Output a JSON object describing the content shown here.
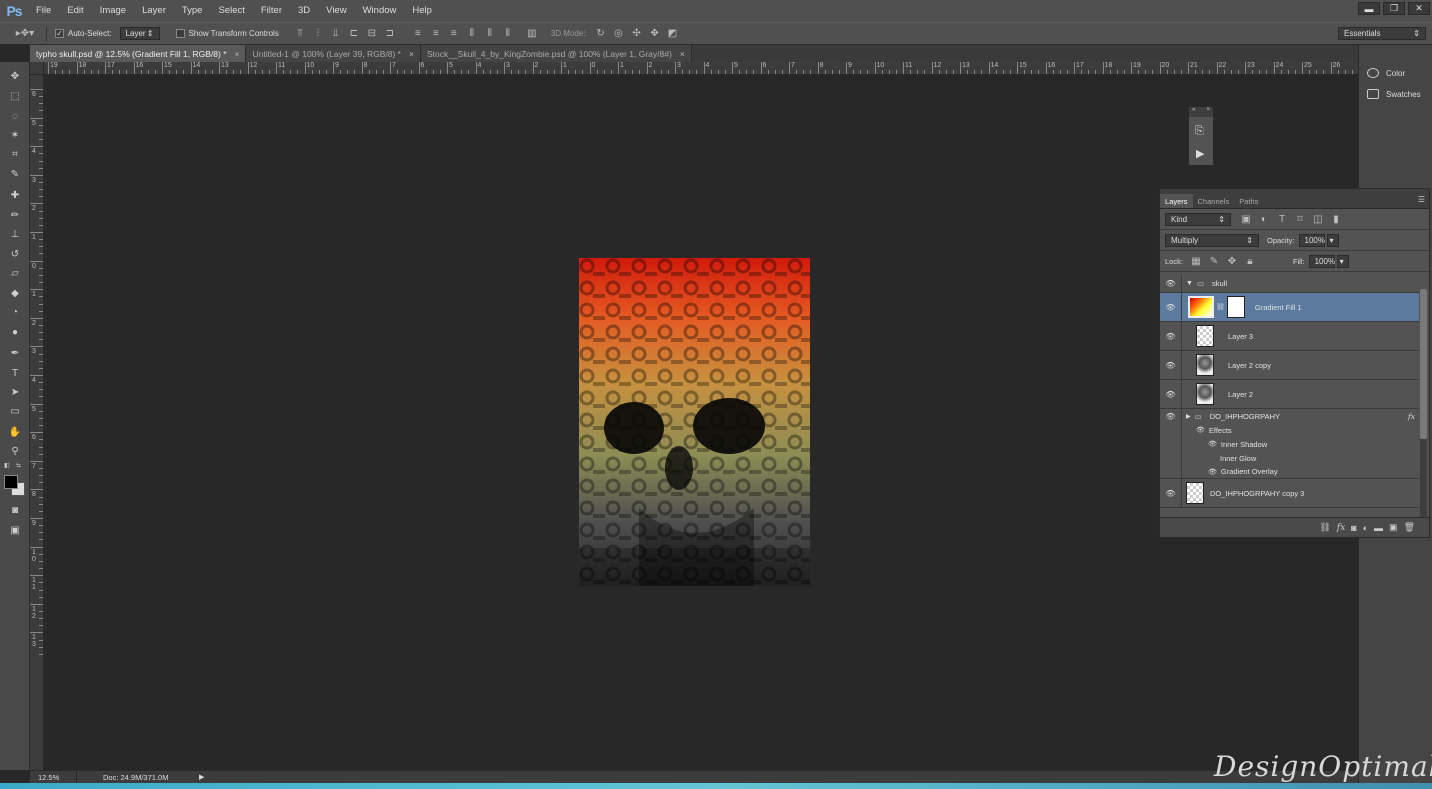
{
  "app": {
    "logo": "Ps"
  },
  "menu": [
    "File",
    "Edit",
    "Image",
    "Layer",
    "Type",
    "Select",
    "Filter",
    "3D",
    "View",
    "Window",
    "Help"
  ],
  "window_controls": {
    "minimize": "▬",
    "restore": "❐",
    "close": "✕"
  },
  "options_bar": {
    "auto_select_label": "Auto-Select:",
    "auto_select_target": "Layer",
    "show_transform_label": "Show Transform Controls",
    "mode_3d_label": "3D Mode:",
    "workspace": "Essentials"
  },
  "tabs": [
    {
      "label": "typho skull.psd @ 12.5% (Gradient Fill 1, RGB/8) *",
      "active": true
    },
    {
      "label": "Untitled-1 @ 100% (Layer 39, RGB/8) *",
      "active": false
    },
    {
      "label": "Stock__Skull_4_by_KingZombie.psd @ 100% (Layer 1, Gray/8#)",
      "active": false
    }
  ],
  "ruler_h": [
    "19",
    "18",
    "17",
    "16",
    "15",
    "14",
    "13",
    "12",
    "11",
    "10",
    "9",
    "8",
    "7",
    "6",
    "5",
    "4",
    "3",
    "2",
    "1",
    "0",
    "1",
    "2",
    "3",
    "4",
    "5",
    "6",
    "7",
    "8",
    "9",
    "10",
    "11",
    "12",
    "13",
    "14",
    "15",
    "16",
    "17",
    "18",
    "19",
    "20",
    "21",
    "22",
    "23",
    "24",
    "25",
    "26",
    "27"
  ],
  "ruler_v": [
    "6",
    "5",
    "4",
    "3",
    "2",
    "1",
    "0",
    "1",
    "2",
    "3",
    "4",
    "5",
    "6",
    "7",
    "8",
    "9",
    "1 0",
    "1 1",
    "1 2",
    "1 3"
  ],
  "status": {
    "zoom": "12.5%",
    "doc": "Doc: 24.9M/371.0M"
  },
  "dock": {
    "color": "Color",
    "swatches": "Swatches"
  },
  "layers_panel": {
    "tabs": [
      "Layers",
      "Channels",
      "Paths"
    ],
    "filter": "Kind",
    "blend_mode": "Multiply",
    "opacity_label": "Opacity:",
    "opacity": "100%",
    "lock_label": "Lock:",
    "fill_label": "Fill:",
    "fill": "100%",
    "layers": [
      {
        "name": "skull",
        "type": "group"
      },
      {
        "name": "Gradient Fill 1",
        "type": "fill",
        "selected": true
      },
      {
        "name": "Layer 3",
        "type": "layer"
      },
      {
        "name": "Layer 2 copy",
        "type": "layer"
      },
      {
        "name": "Layer 2",
        "type": "layer"
      },
      {
        "name": "DO_IHPHOGRPAHY",
        "type": "group-fx"
      },
      {
        "name": "Effects",
        "type": "effects"
      },
      {
        "name": "Inner Shadow",
        "type": "effect"
      },
      {
        "name": "Inner Glow",
        "type": "effect"
      },
      {
        "name": "Gradient Overlay",
        "type": "effect"
      },
      {
        "name": "DO_IHPHOGRPAHY copy 3",
        "type": "layer"
      }
    ]
  },
  "watermark": "DesignOptimal.com"
}
